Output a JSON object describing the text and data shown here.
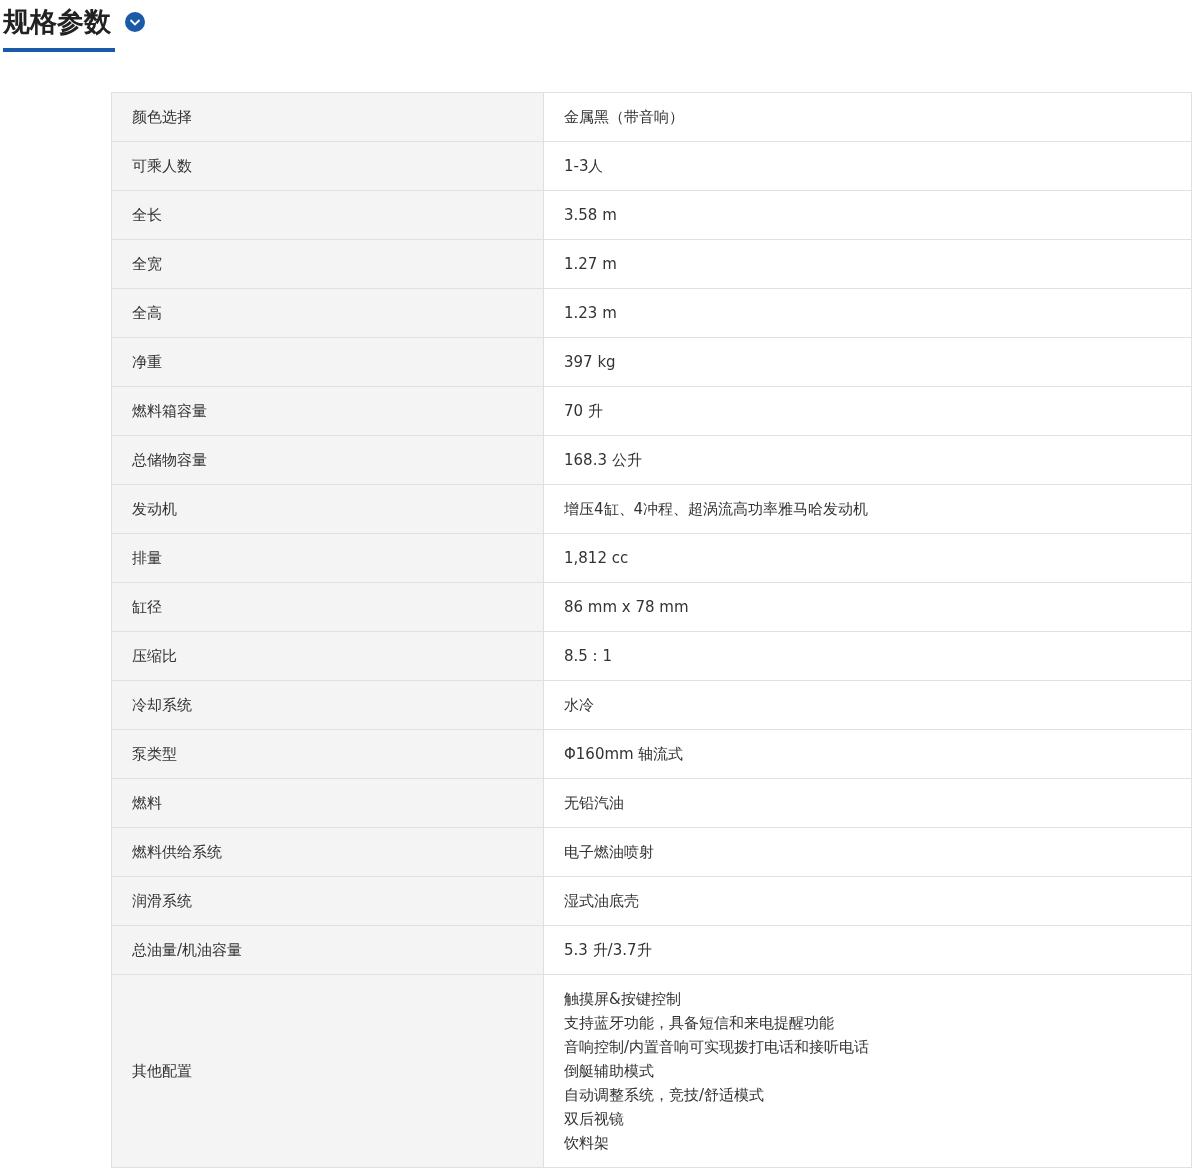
{
  "section": {
    "title": "规格参数"
  },
  "spec_table": {
    "rows": [
      {
        "label": "颜色选择",
        "value": [
          "金属黑（带音响）"
        ]
      },
      {
        "label": "可乘人数",
        "value": [
          "1-3人"
        ]
      },
      {
        "label": "全长",
        "value": [
          "3.58 m"
        ]
      },
      {
        "label": "全宽",
        "value": [
          "1.27 m"
        ]
      },
      {
        "label": "全高",
        "value": [
          "1.23 m"
        ]
      },
      {
        "label": "净重",
        "value": [
          "397 kg"
        ]
      },
      {
        "label": "燃料箱容量",
        "value": [
          "70 升"
        ]
      },
      {
        "label": "总储物容量",
        "value": [
          "168.3 公升"
        ]
      },
      {
        "label": "发动机",
        "value": [
          "增压4缸、4冲程、超涡流高功率雅马哈发动机"
        ]
      },
      {
        "label": "排量",
        "value": [
          "1,812 cc"
        ]
      },
      {
        "label": "缸径",
        "value": [
          "86 mm x 78 mm"
        ]
      },
      {
        "label": "压缩比",
        "value": [
          "8.5 : 1"
        ]
      },
      {
        "label": "冷却系统",
        "value": [
          "水冷"
        ]
      },
      {
        "label": "泵类型",
        "value": [
          "Φ160mm 轴流式"
        ]
      },
      {
        "label": "燃料",
        "value": [
          "无铅汽油"
        ]
      },
      {
        "label": "燃料供给系统",
        "value": [
          "电子燃油喷射"
        ]
      },
      {
        "label": "润滑系统",
        "value": [
          "湿式油底壳"
        ]
      },
      {
        "label": "总油量/机油容量",
        "value": [
          "5.3 升/3.7升"
        ]
      },
      {
        "label": "其他配置",
        "value": [
          "触摸屏&按键控制",
          "支持蓝牙功能，具备短信和来电提醒功能",
          "音响控制/内置音响可实现拨打电话和接听电话",
          "倒艇辅助模式",
          "自动调整系统，竞技/舒适模式",
          "双后视镜",
          "饮料架"
        ]
      }
    ]
  }
}
